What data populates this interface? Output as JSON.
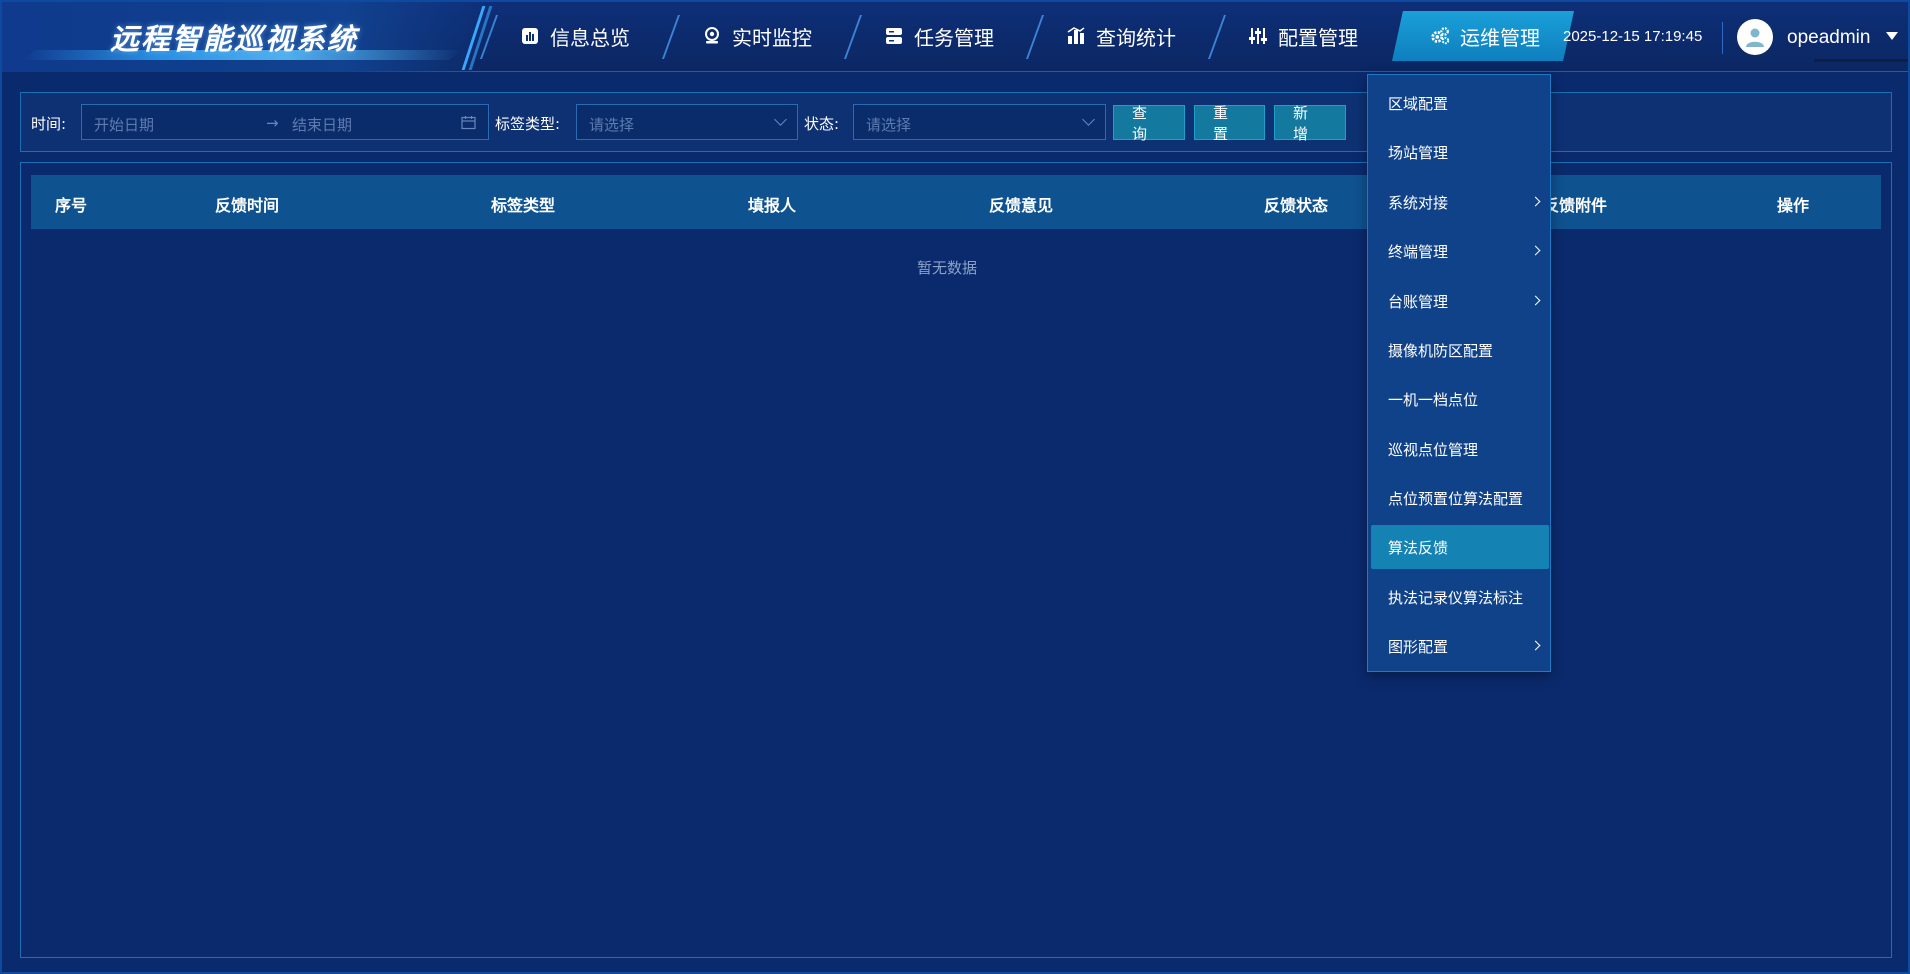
{
  "app": {
    "title": "远程智能巡视系统"
  },
  "nav": {
    "items": [
      {
        "label": "信息总览",
        "icon": "chart-bar-icon"
      },
      {
        "label": "实时监控",
        "icon": "webcam-icon"
      },
      {
        "label": "任务管理",
        "icon": "server-icon"
      },
      {
        "label": "查询统计",
        "icon": "stats-icon"
      },
      {
        "label": "配置管理",
        "icon": "sliders-icon"
      },
      {
        "label": "运维管理",
        "icon": "gears-icon",
        "active": true
      }
    ]
  },
  "header": {
    "datetime": "2025-12-15 17:19:45",
    "username": "opeadmin"
  },
  "filters": {
    "time_label": "时间:",
    "start_placeholder": "开始日期",
    "end_placeholder": "结束日期",
    "date_separator": "→",
    "tag_type_label": "标签类型:",
    "tag_type_placeholder": "请选择",
    "status_label": "状态:",
    "status_placeholder": "请选择",
    "query_button": "查 询",
    "reset_button": "重 置",
    "add_button": "新 增"
  },
  "table": {
    "columns": [
      "序号",
      "反馈时间",
      "标签类型",
      "填报人",
      "反馈意见",
      "反馈状态",
      "反馈附件",
      "操作"
    ],
    "empty_text": "暂无数据"
  },
  "menu": {
    "items": [
      {
        "label": "区域配置",
        "has_submenu": false
      },
      {
        "label": "场站管理",
        "has_submenu": false
      },
      {
        "label": "系统对接",
        "has_submenu": true
      },
      {
        "label": "终端管理",
        "has_submenu": true
      },
      {
        "label": "台账管理",
        "has_submenu": true
      },
      {
        "label": "摄像机防区配置",
        "has_submenu": false
      },
      {
        "label": "一机一档点位",
        "has_submenu": false
      },
      {
        "label": "巡视点位管理",
        "has_submenu": false
      },
      {
        "label": "点位预置位算法配置",
        "has_submenu": false
      },
      {
        "label": "算法反馈",
        "has_submenu": false,
        "active": true
      },
      {
        "label": "执法记录仪算法标注",
        "has_submenu": false
      },
      {
        "label": "图形配置",
        "has_submenu": true
      }
    ]
  },
  "colors": {
    "background": "#0a2a6e",
    "accent": "#1483b3",
    "header_active": "#1aa0d8"
  }
}
